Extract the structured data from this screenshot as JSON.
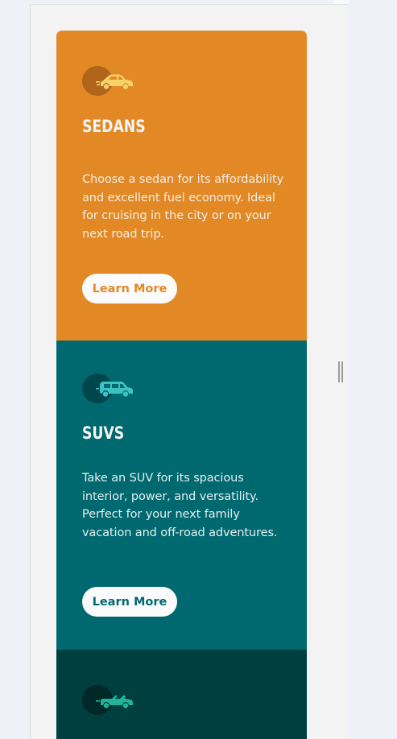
{
  "cards": [
    {
      "id": "sedans",
      "icon": "sedan-car-icon",
      "title": "SEDANS",
      "body": "Choose a sedan for its affordability and excellent fuel economy. Ideal for cruising in the city or on your next road trip.",
      "button_label": "Learn More",
      "color": "#e28926"
    },
    {
      "id": "suvs",
      "icon": "suv-car-icon",
      "title": "SUVS",
      "body": "Take an SUV for its spacious interior, power, and versatility. Perfect for your next family vacation and off-road adventures.",
      "button_label": "Learn More",
      "color": "#006970"
    },
    {
      "id": "luxury",
      "icon": "luxury-car-icon",
      "color": "#003f3f"
    }
  ],
  "colors": {
    "page_background": "#eef1f8",
    "viewport_background": "#f3f3f3",
    "button_background": "#fbfbfb",
    "heading_text": "#f5f5f5"
  }
}
